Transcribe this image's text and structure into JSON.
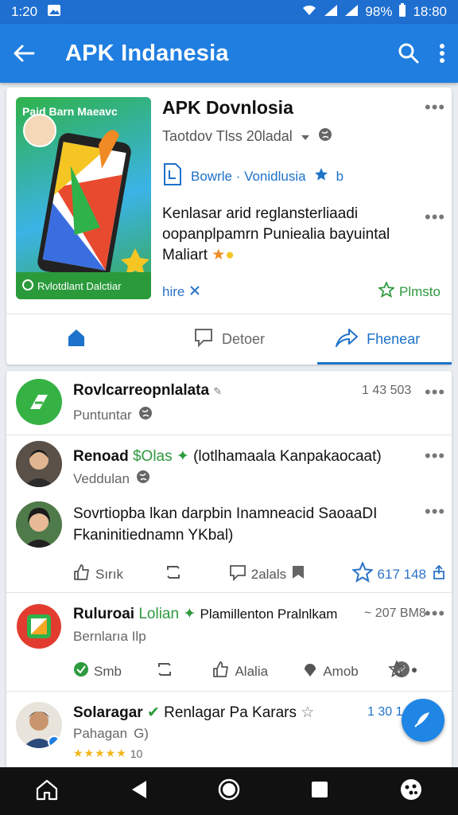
{
  "status": {
    "time": "1:20",
    "battery": "98%",
    "clock": "18:80"
  },
  "appbar": {
    "title": "APK Indanesia"
  },
  "featured": {
    "thumb_title": "Paid Barn Maeavc",
    "thumb_caption": "Rvlotdlant Dalctiar",
    "title": "APK Dovnlosia",
    "subtitle": "Taotdov Tlss 20ladal",
    "download_label": "Bowrle · Vonidlusia",
    "download_badge": "b",
    "description": "Kenlasar arid reglansterliaadi oopanplpamrn Puniealia bayuintal Maliart",
    "more_label": "hire",
    "promo_label": "Plmsto",
    "tabs": [
      "",
      "Detoer",
      "Fhenear"
    ]
  },
  "posts": [
    {
      "name": "Rovlcarreopnlalata",
      "subtitle": "Puntuntar",
      "count": "1 43 503"
    },
    {
      "name": "Renoad",
      "tag": "Olas",
      "name_rest": "(lotlhamaala Kanpakaocaat)",
      "subtitle": "Veddulan"
    },
    {
      "text": "Sovrtiopba lkan darpbin Inamneacid SaoaaDI Fkaninitiednamn YKbal)",
      "actions": [
        "Sırık",
        "",
        "2alals",
        "",
        "617 148"
      ]
    },
    {
      "name": "Ruluroai",
      "tag": "Lolian",
      "name_rest": "Plamillenton Pralnlkam",
      "count": "~ 207 BM8",
      "subtitle": "Bernlarıa Ilp",
      "actions": [
        "Smb",
        "",
        "Alalia",
        "Amob",
        ""
      ]
    },
    {
      "name": "Solaragar",
      "name_rest": "Renlagar Pa Karars",
      "count": "1 30 1.",
      "subtitle": "Pahagan",
      "subtitle_tag": "G)",
      "rating_count": "10"
    }
  ],
  "colors": {
    "primary": "#1f7ee0",
    "accent": "#2e9a3e",
    "link": "#1d72c9"
  }
}
